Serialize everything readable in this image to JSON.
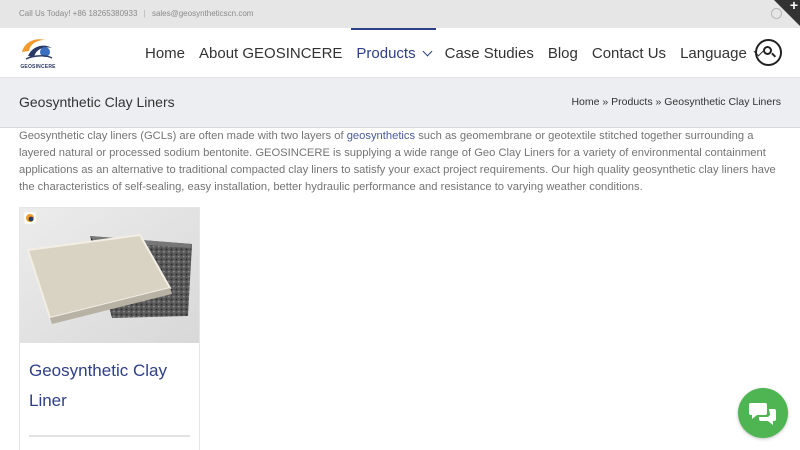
{
  "topbar": {
    "phone": "Call Us Today! +86 18265380933",
    "separator": "|",
    "email": "sales@geosyntheticscn.com"
  },
  "brand": {
    "logo_text": "GEOSINCERE"
  },
  "nav": {
    "items": [
      {
        "label": "Home"
      },
      {
        "label": "About GEOSINCERE"
      },
      {
        "label": "Products",
        "active": true
      },
      {
        "label": "Case Studies"
      },
      {
        "label": "Blog"
      },
      {
        "label": "Contact Us"
      },
      {
        "label": "Language"
      }
    ]
  },
  "page": {
    "title": "Geosynthetic Clay Liners",
    "breadcrumb": {
      "home": "Home",
      "sep1": "»",
      "products": "Products",
      "sep2": "»",
      "current": "Geosynthetic Clay Liners"
    },
    "intro": {
      "part1": "Geosynthetic clay liners (GCLs) are often made with two layers of ",
      "link": "geosynthetics",
      "part2": " such as geomembrane or geotextile stitched together surrounding a layered natural or processed sodium bentonite. GEOSINCERE is supplying a wide range of Geo Clay Liners for a variety of environmental containment applications as an alternative to traditional compacted clay liners to satisfy your exact project requirements. Our high quality geosynthetic clay liners have the characteristics of self-sealing, easy installation, better hydraulic performance and resistance to varying weather conditions."
    }
  },
  "products": [
    {
      "title": "Geosynthetic Clay Liner"
    }
  ],
  "colors": {
    "accent": "#2f3f88",
    "topbar_bg": "#e6e6e6",
    "titlebar_bg": "#eceef1",
    "chat_green": "#4fb553"
  },
  "icons": {
    "whatsapp": "whatsapp-icon",
    "search": "search-icon",
    "chat": "chat-bubbles-icon",
    "dropdown": "chevron-down-icon"
  }
}
